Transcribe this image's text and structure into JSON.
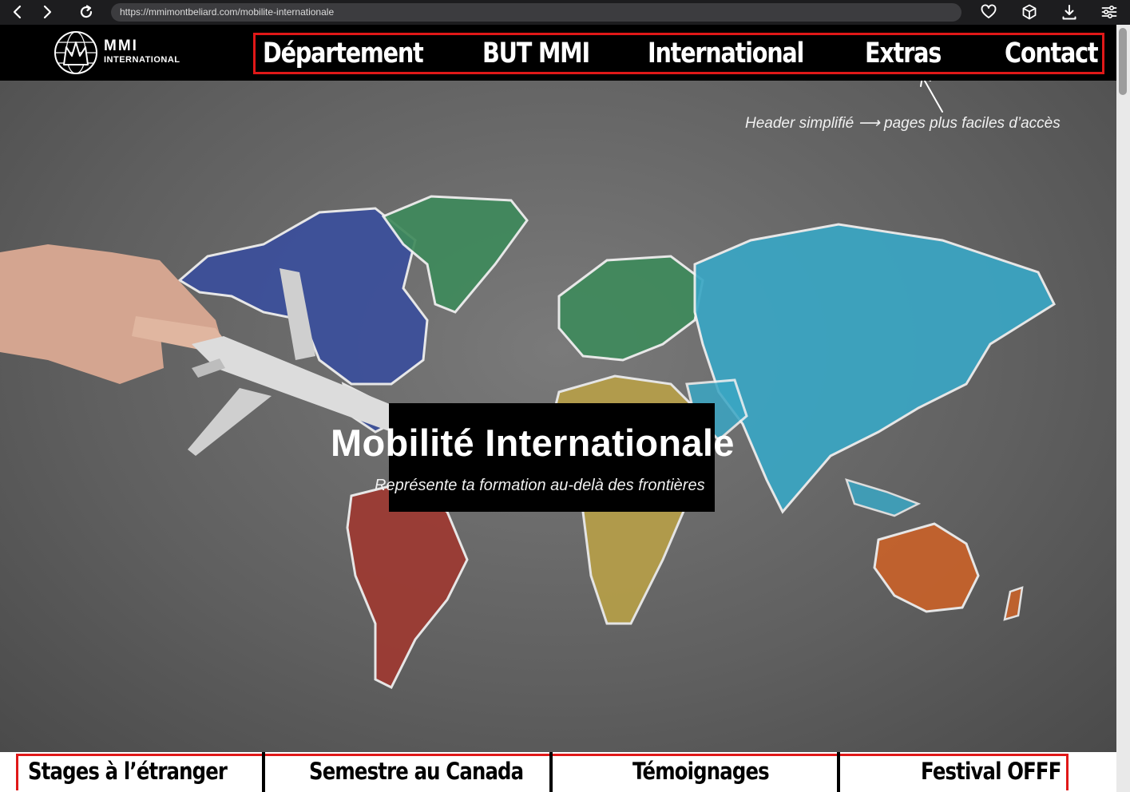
{
  "browser": {
    "url": "https://mmimontbeliard.com/mobilite-internationale",
    "icons": [
      "back-icon",
      "forward-icon",
      "reload-icon",
      "heart-icon",
      "cube-icon",
      "download-icon",
      "sliders-icon"
    ]
  },
  "logo": {
    "top": "MMI",
    "bottom": "INTERNATIONAL"
  },
  "nav": {
    "items": [
      {
        "label": "Département"
      },
      {
        "label": "BUT MMI"
      },
      {
        "label": "International"
      },
      {
        "label": "Extras"
      },
      {
        "label": "Contact"
      }
    ]
  },
  "annotation": "Header simplifié ⟶ pages plus faciles d’accès",
  "hero": {
    "title": "Mobilité Internationale",
    "subtitle": "Représente ta formation au-delà des frontières"
  },
  "subnav": {
    "items": [
      {
        "label": "Stages à l’étranger"
      },
      {
        "label": "Semestre au Canada"
      },
      {
        "label": "Témoignages"
      },
      {
        "label": "Festival OFFF"
      }
    ]
  },
  "colors": {
    "accent_outline": "#e01818",
    "header_bg": "#000000",
    "chalk_board": "#5f5f5f"
  }
}
